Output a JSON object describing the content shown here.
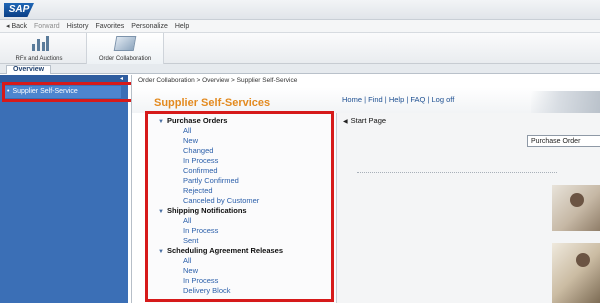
{
  "topbar": {
    "logo_text": "SAP"
  },
  "menubar": {
    "items": [
      {
        "label": "◂ Back",
        "dim": false
      },
      {
        "label": "Forward",
        "dim": true
      },
      {
        "label": "History",
        "dim": false
      },
      {
        "label": "Favorites",
        "dim": false
      },
      {
        "label": "Personalize",
        "dim": false
      },
      {
        "label": "Help",
        "dim": false
      }
    ]
  },
  "app_tabs": [
    {
      "label": "RFx and Auctions",
      "icon": "bar-chart-icon"
    },
    {
      "label": "Order Collaboration",
      "icon": "order-collaboration-icon"
    }
  ],
  "overview_tab": "Overview",
  "sidebar": {
    "collapse_glyph": "◂",
    "items": [
      {
        "label": "Supplier Self-Service",
        "bullet": "•"
      }
    ]
  },
  "breadcrumb": "Order Collaboration  >  Overview  >  Supplier Self-Service",
  "header": {
    "title": "Supplier Self-Services",
    "links": "Home | Find | Help | FAQ | Log off"
  },
  "navigation": {
    "groups": [
      {
        "label": "Purchase Orders",
        "items": [
          "All",
          "New",
          "Changed",
          "In Process",
          "Confirmed",
          "Partly Confirmed",
          "Rejected",
          "Canceled by Customer"
        ]
      },
      {
        "label": "Shipping Notifications",
        "items": [
          "All",
          "In Process",
          "Sent"
        ]
      },
      {
        "label": "Scheduling Agreement Releases",
        "items": [
          "All",
          "New",
          "In Process",
          "Delivery Block"
        ]
      }
    ]
  },
  "start_page": {
    "label": "Start Page",
    "search_box": "Purchase Order"
  },
  "colors": {
    "sidebar": "#3b6fb6",
    "title": "#e38a1f",
    "link": "#2b5faa",
    "highlight": "#d61a1a"
  }
}
